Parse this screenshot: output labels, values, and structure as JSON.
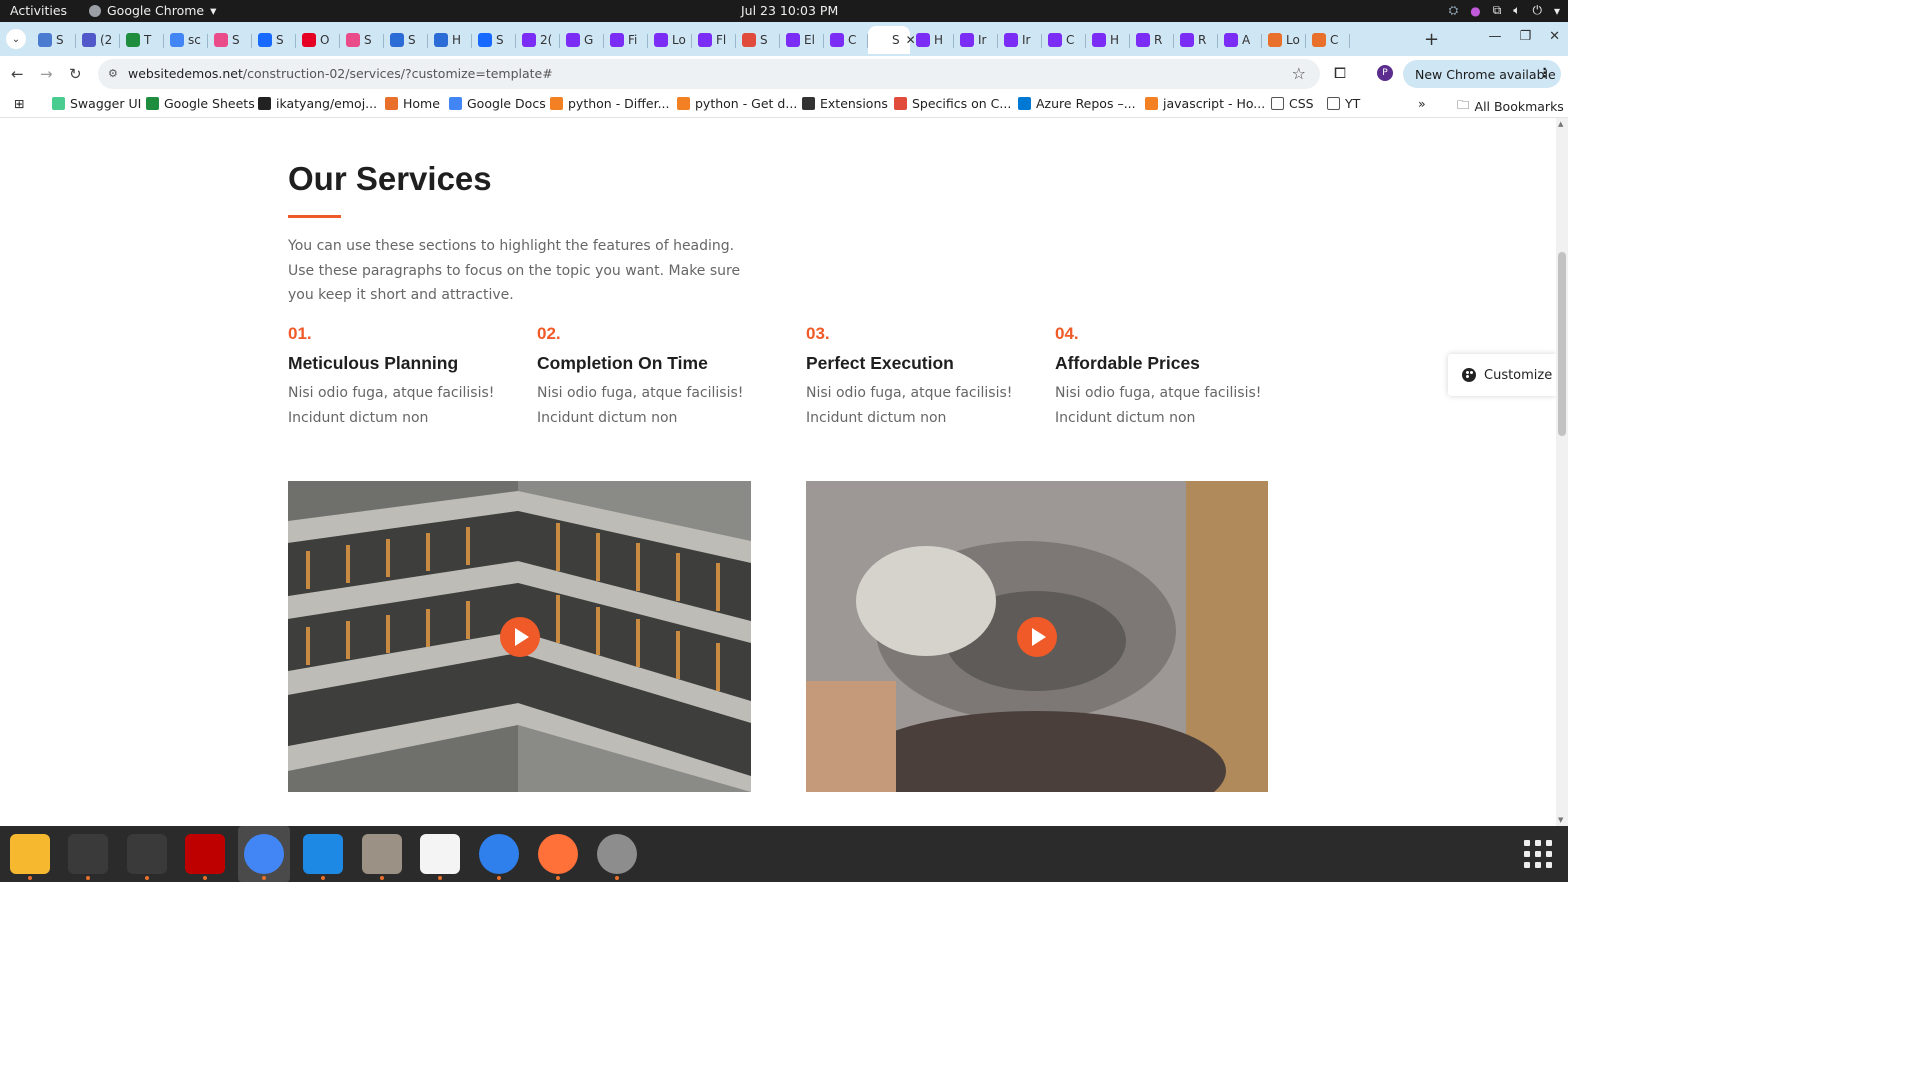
{
  "system": {
    "activities": "Activities",
    "app_menu": "Google Chrome",
    "clock": "Jul 23  10:03 PM"
  },
  "tabs": [
    {
      "letter": "S",
      "color": "#4a7bd0"
    },
    {
      "letter": "(2",
      "color": "#5059c9"
    },
    {
      "letter": "T",
      "color": "#1e8e3e"
    },
    {
      "letter": "sc",
      "color": "#4285f4"
    },
    {
      "letter": "S",
      "color": "#ea4c89"
    },
    {
      "letter": "S",
      "color": "#1769ff"
    },
    {
      "letter": "O",
      "color": "#e60023"
    },
    {
      "letter": "S",
      "color": "#ea4c89"
    },
    {
      "letter": "S",
      "color": "#2b6cd6"
    },
    {
      "letter": "H",
      "color": "#2b6cd6"
    },
    {
      "letter": "S",
      "color": "#1769ff"
    },
    {
      "letter": "2(",
      "color": "#7b2cf5"
    },
    {
      "letter": "G",
      "color": "#7b2cf5"
    },
    {
      "letter": "Fi",
      "color": "#7b2cf5"
    },
    {
      "letter": "Lo",
      "color": "#7b2cf5"
    },
    {
      "letter": "Fl",
      "color": "#7b2cf5"
    },
    {
      "letter": "S",
      "color": "#e04b3c"
    },
    {
      "letter": "El",
      "color": "#7b2cf5"
    },
    {
      "letter": "C",
      "color": "#7b2cf5"
    },
    {
      "letter": "S",
      "color": "#ffffff",
      "active": true
    },
    {
      "letter": "H",
      "color": "#7b2cf5"
    },
    {
      "letter": "Ir",
      "color": "#7b2cf5"
    },
    {
      "letter": "Ir",
      "color": "#7b2cf5"
    },
    {
      "letter": "C",
      "color": "#7b2cf5"
    },
    {
      "letter": "H",
      "color": "#7b2cf5"
    },
    {
      "letter": "R",
      "color": "#7b2cf5"
    },
    {
      "letter": "R",
      "color": "#7b2cf5"
    },
    {
      "letter": "A",
      "color": "#7b2cf5"
    },
    {
      "letter": "Lo",
      "color": "#e8702a"
    },
    {
      "letter": "C",
      "color": "#e8702a"
    }
  ],
  "toolbar": {
    "url_domain": "websitedemos.net",
    "url_path": "/construction-02/services/?customize=template#",
    "profile_initial": "P",
    "update_label": "New Chrome available"
  },
  "bookmarks": [
    {
      "label": "Swagger UI",
      "color": "#49cc90"
    },
    {
      "label": "Google Sheets",
      "color": "#1e8e3e"
    },
    {
      "label": "ikatyang/emoj...",
      "color": "#222222"
    },
    {
      "label": "Home",
      "color": "#e8702a"
    },
    {
      "label": "Google Docs",
      "color": "#4285f4"
    },
    {
      "label": "python - Differ...",
      "color": "#f48024"
    },
    {
      "label": "python - Get d...",
      "color": "#f48024"
    },
    {
      "label": "Extensions",
      "color": "#333333"
    },
    {
      "label": "Specifics on C...",
      "color": "#e04b3c"
    },
    {
      "label": "Azure Repos –...",
      "color": "#0078d4"
    },
    {
      "label": "javascript - Ho...",
      "color": "#f48024"
    },
    {
      "label": "CSS",
      "color": "#555555"
    },
    {
      "label": "YT",
      "color": "#555555"
    }
  ],
  "all_bookmarks": "All Bookmarks",
  "page": {
    "title": "Our Services",
    "intro": "You can use these sections to highlight the features of heading. Use these paragraphs to focus on the topic you want. Make sure you keep it short and attractive.",
    "features": [
      {
        "num": "01.",
        "title": "Meticulous Planning",
        "desc_1": "Nisi odio fuga, atque facilisis!",
        "desc_2": "Incidunt dictum non"
      },
      {
        "num": "02.",
        "title": "Completion On Time",
        "desc_1": "Nisi odio fuga, atque facilisis!",
        "desc_2": "Incidunt dictum non"
      },
      {
        "num": "03.",
        "title": "Perfect Execution",
        "desc_1": "Nisi odio fuga, atque facilisis!",
        "desc_2": "Incidunt dictum non"
      },
      {
        "num": "04.",
        "title": "Affordable Prices",
        "desc_1": "Nisi odio fuga, atque facilisis!",
        "desc_2": "Incidunt dictum non"
      }
    ],
    "customize_label": "Customize",
    "accent_color": "#f05a28"
  },
  "dock": [
    {
      "name": "notes-app-icon",
      "color": "#f5b82e"
    },
    {
      "name": "system-monitor-icon",
      "color": "#3a3a3a"
    },
    {
      "name": "terminal-icon",
      "color": "#3a3a3a"
    },
    {
      "name": "filezilla-icon",
      "color": "#bf0000"
    },
    {
      "name": "chrome-icon",
      "color": "#4285f4"
    },
    {
      "name": "vscode-icon",
      "color": "#1e88e5"
    },
    {
      "name": "files-icon",
      "color": "#9b9185"
    },
    {
      "name": "text-editor-icon",
      "color": "#f4f4f4"
    },
    {
      "name": "thunderbird-icon",
      "color": "#2f80ed"
    },
    {
      "name": "firefox-icon",
      "color": "#ff7139"
    },
    {
      "name": "disks-icon",
      "color": "#8d8d8d"
    }
  ]
}
